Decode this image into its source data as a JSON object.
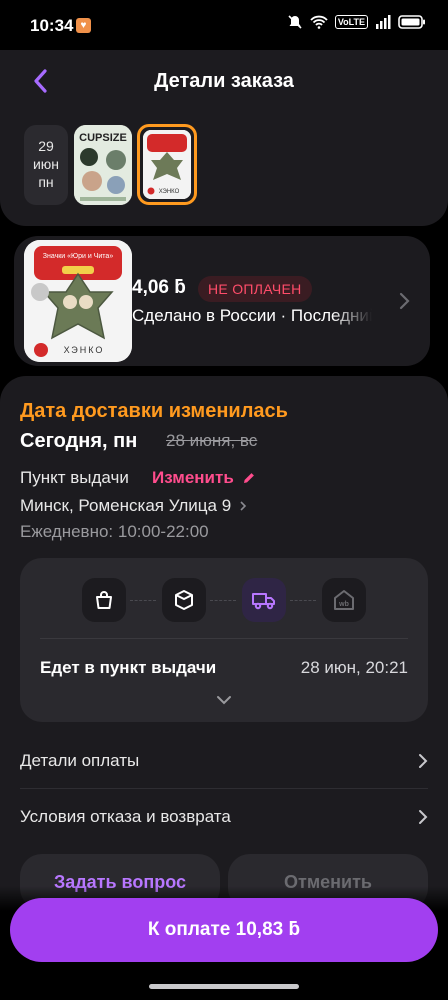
{
  "status_bar": {
    "time": "10:34",
    "volte": "VoLTE"
  },
  "header": {
    "title": "Детали заказа"
  },
  "date_chip": {
    "day": "29",
    "month": "июн",
    "weekday": "пн"
  },
  "thumbnails": [
    {
      "label": "CUPSIZE"
    },
    {
      "label": "ХЭНКО"
    }
  ],
  "product": {
    "price": "4,06 ƃ",
    "badge": "НЕ ОПЛАЧЕН",
    "origin": "Сделано в России · Последний",
    "image_title": "Значки «Юри и Чита»",
    "image_brand": "ХЭНКО"
  },
  "delivery": {
    "changed_label": "Дата доставки изменилась",
    "new_date": "Сегодня, пн",
    "old_date": "28 июня, вс",
    "pickup_label": "Пункт выдачи",
    "change_link": "Изменить",
    "address": "Минск, Роменская Улица 9",
    "hours": "Ежедневно: 10:00-22:00"
  },
  "tracker": {
    "steps": [
      {
        "icon": "bag-icon",
        "active": false
      },
      {
        "icon": "box-icon",
        "active": false
      },
      {
        "icon": "truck-icon",
        "active": true
      },
      {
        "icon": "pickup-point-icon",
        "active": false
      }
    ],
    "status": "Едет в пункт выдачи",
    "date": "28 июн, 20:21"
  },
  "rows": [
    {
      "label": "Детали оплаты"
    },
    {
      "label": "Условия отказа и возврата"
    }
  ],
  "buttons": {
    "ask": "Задать вопрос",
    "cancel": "Отменить",
    "pay": "К оплате 10,83 ƃ"
  },
  "colors": {
    "accent": "#a23ff0",
    "orange": "#ff9a1f",
    "pink": "#ff4d8d",
    "unpaid": "#ff4d6a"
  }
}
